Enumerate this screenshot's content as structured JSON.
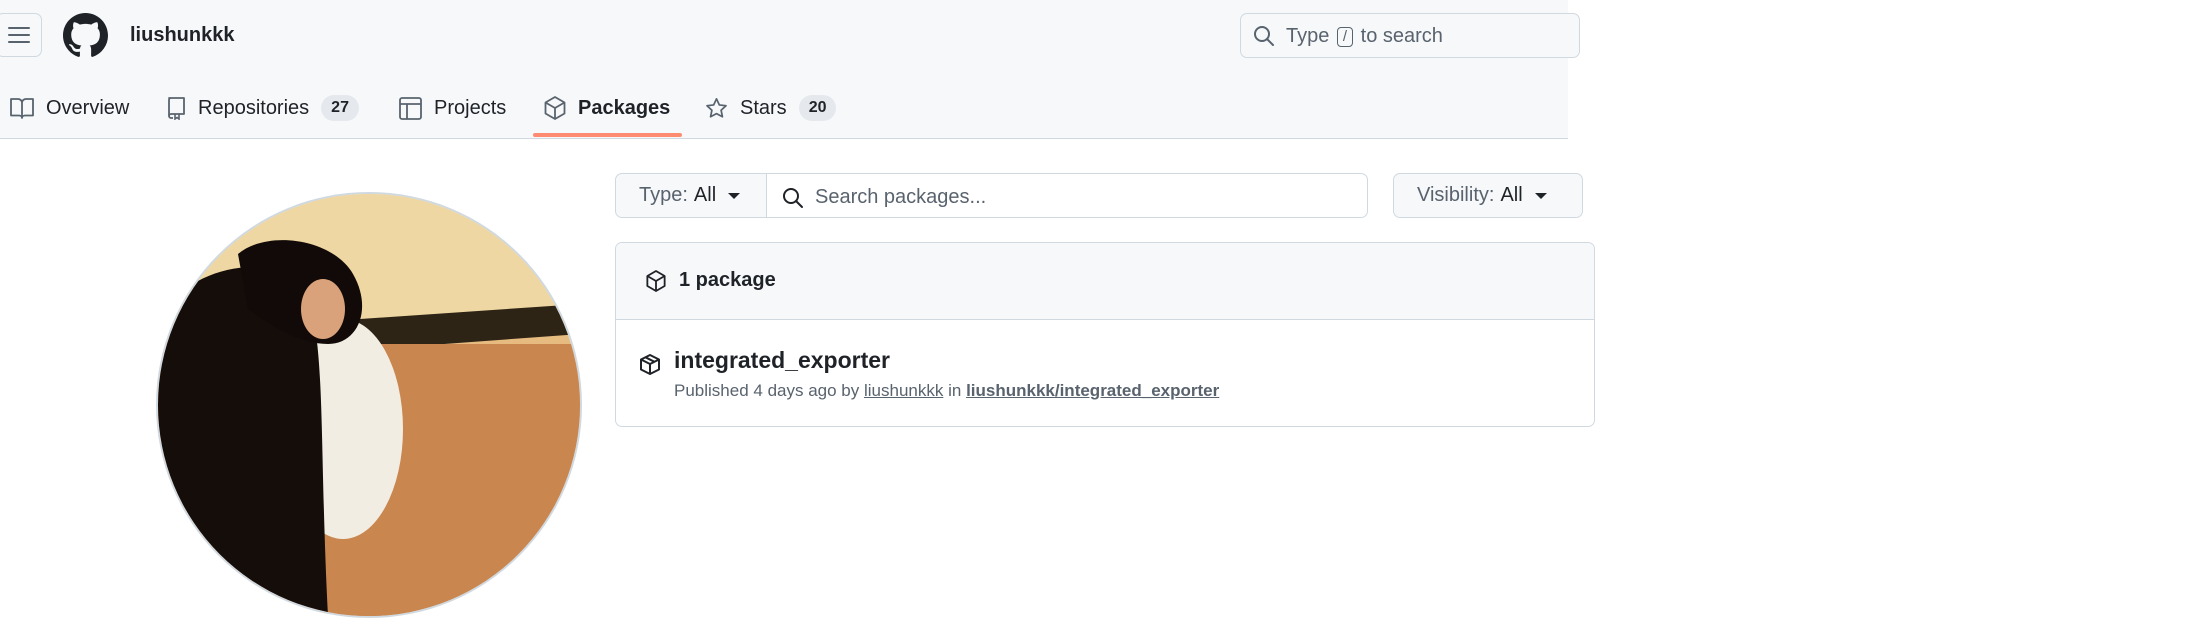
{
  "header": {
    "username": "liushunkkk",
    "search": {
      "prefix": "Type",
      "key": "/",
      "suffix": "to search"
    }
  },
  "nav": {
    "tabs": [
      {
        "label": "Overview",
        "icon": "book-icon"
      },
      {
        "label": "Repositories",
        "icon": "repo-icon",
        "count": "27"
      },
      {
        "label": "Projects",
        "icon": "table-icon"
      },
      {
        "label": "Packages",
        "icon": "package-icon",
        "active": true
      },
      {
        "label": "Stars",
        "icon": "star-icon",
        "count": "20"
      }
    ]
  },
  "filters": {
    "type_label": "Type:",
    "type_value": "All",
    "search_placeholder": "Search packages...",
    "visibility_label": "Visibility:",
    "visibility_value": "All"
  },
  "packages": {
    "count_label": "1 package",
    "items": [
      {
        "name": "integrated_exporter",
        "published_prefix": "Published 4 days ago by",
        "author": "liushunkkk",
        "in_word": "in",
        "repo": "liushunkkk/integrated_exporter"
      }
    ]
  },
  "colors": {
    "header_bg": "#f6f8fa",
    "border": "#d1d9e0",
    "active_underline": "#fd8c73",
    "text": "#1f2328",
    "muted": "#59636e"
  }
}
